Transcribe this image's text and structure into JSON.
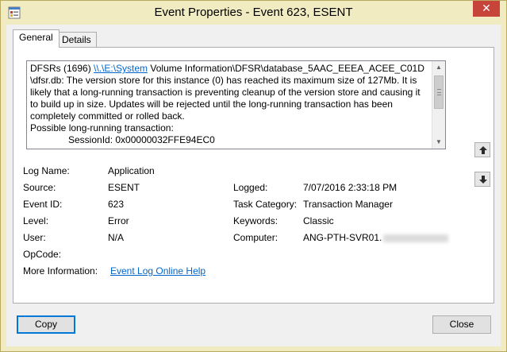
{
  "window": {
    "title": "Event Properties - Event 623, ESENT",
    "close_glyph": "✕"
  },
  "tabs": [
    {
      "label": "General",
      "active": true
    },
    {
      "label": "Details",
      "active": false
    }
  ],
  "description": {
    "line1_prefix": "DFSRs (1696) ",
    "line1_link": "\\\\.\\E:\\System",
    "line1_suffix": " Volume Information\\DFSR\\database_5AAC_EEEA_ACEE_C01D",
    "body": "\\dfsr.db: The version store for this instance (0) has reached its maximum size of 127Mb. It is likely that a long-running transaction is preventing cleanup of the version store and causing it to build up in size. Updates will be rejected until the long-running transaction has been completely committed or rolled back.",
    "possible": "Possible long-running transaction:",
    "session": "SessionId: 0x00000032FFE94EC0"
  },
  "fields": {
    "log_name_label": "Log Name:",
    "log_name": "Application",
    "source_label": "Source:",
    "source": "ESENT",
    "logged_label": "Logged:",
    "logged": "7/07/2016 2:33:18 PM",
    "event_id_label": "Event ID:",
    "event_id": "623",
    "task_category_label": "Task Category:",
    "task_category": "Transaction Manager",
    "level_label": "Level:",
    "level": "Error",
    "keywords_label": "Keywords:",
    "keywords": "Classic",
    "user_label": "User:",
    "user": "N/A",
    "computer_label": "Computer:",
    "computer": "ANG-PTH-SVR01.",
    "opcode_label": "OpCode:",
    "opcode": "",
    "more_info_label": "More Information:",
    "more_info_link": "Event Log Online Help"
  },
  "buttons": {
    "copy": "Copy",
    "close": "Close"
  },
  "icons": {
    "app": "event-viewer-icon",
    "prev": "arrow-up-icon",
    "next": "arrow-down-icon"
  },
  "colors": {
    "titlebar": "#f1ebc1",
    "close_button": "#c7443a",
    "link": "#0066cc",
    "focus": "#0078d7"
  }
}
